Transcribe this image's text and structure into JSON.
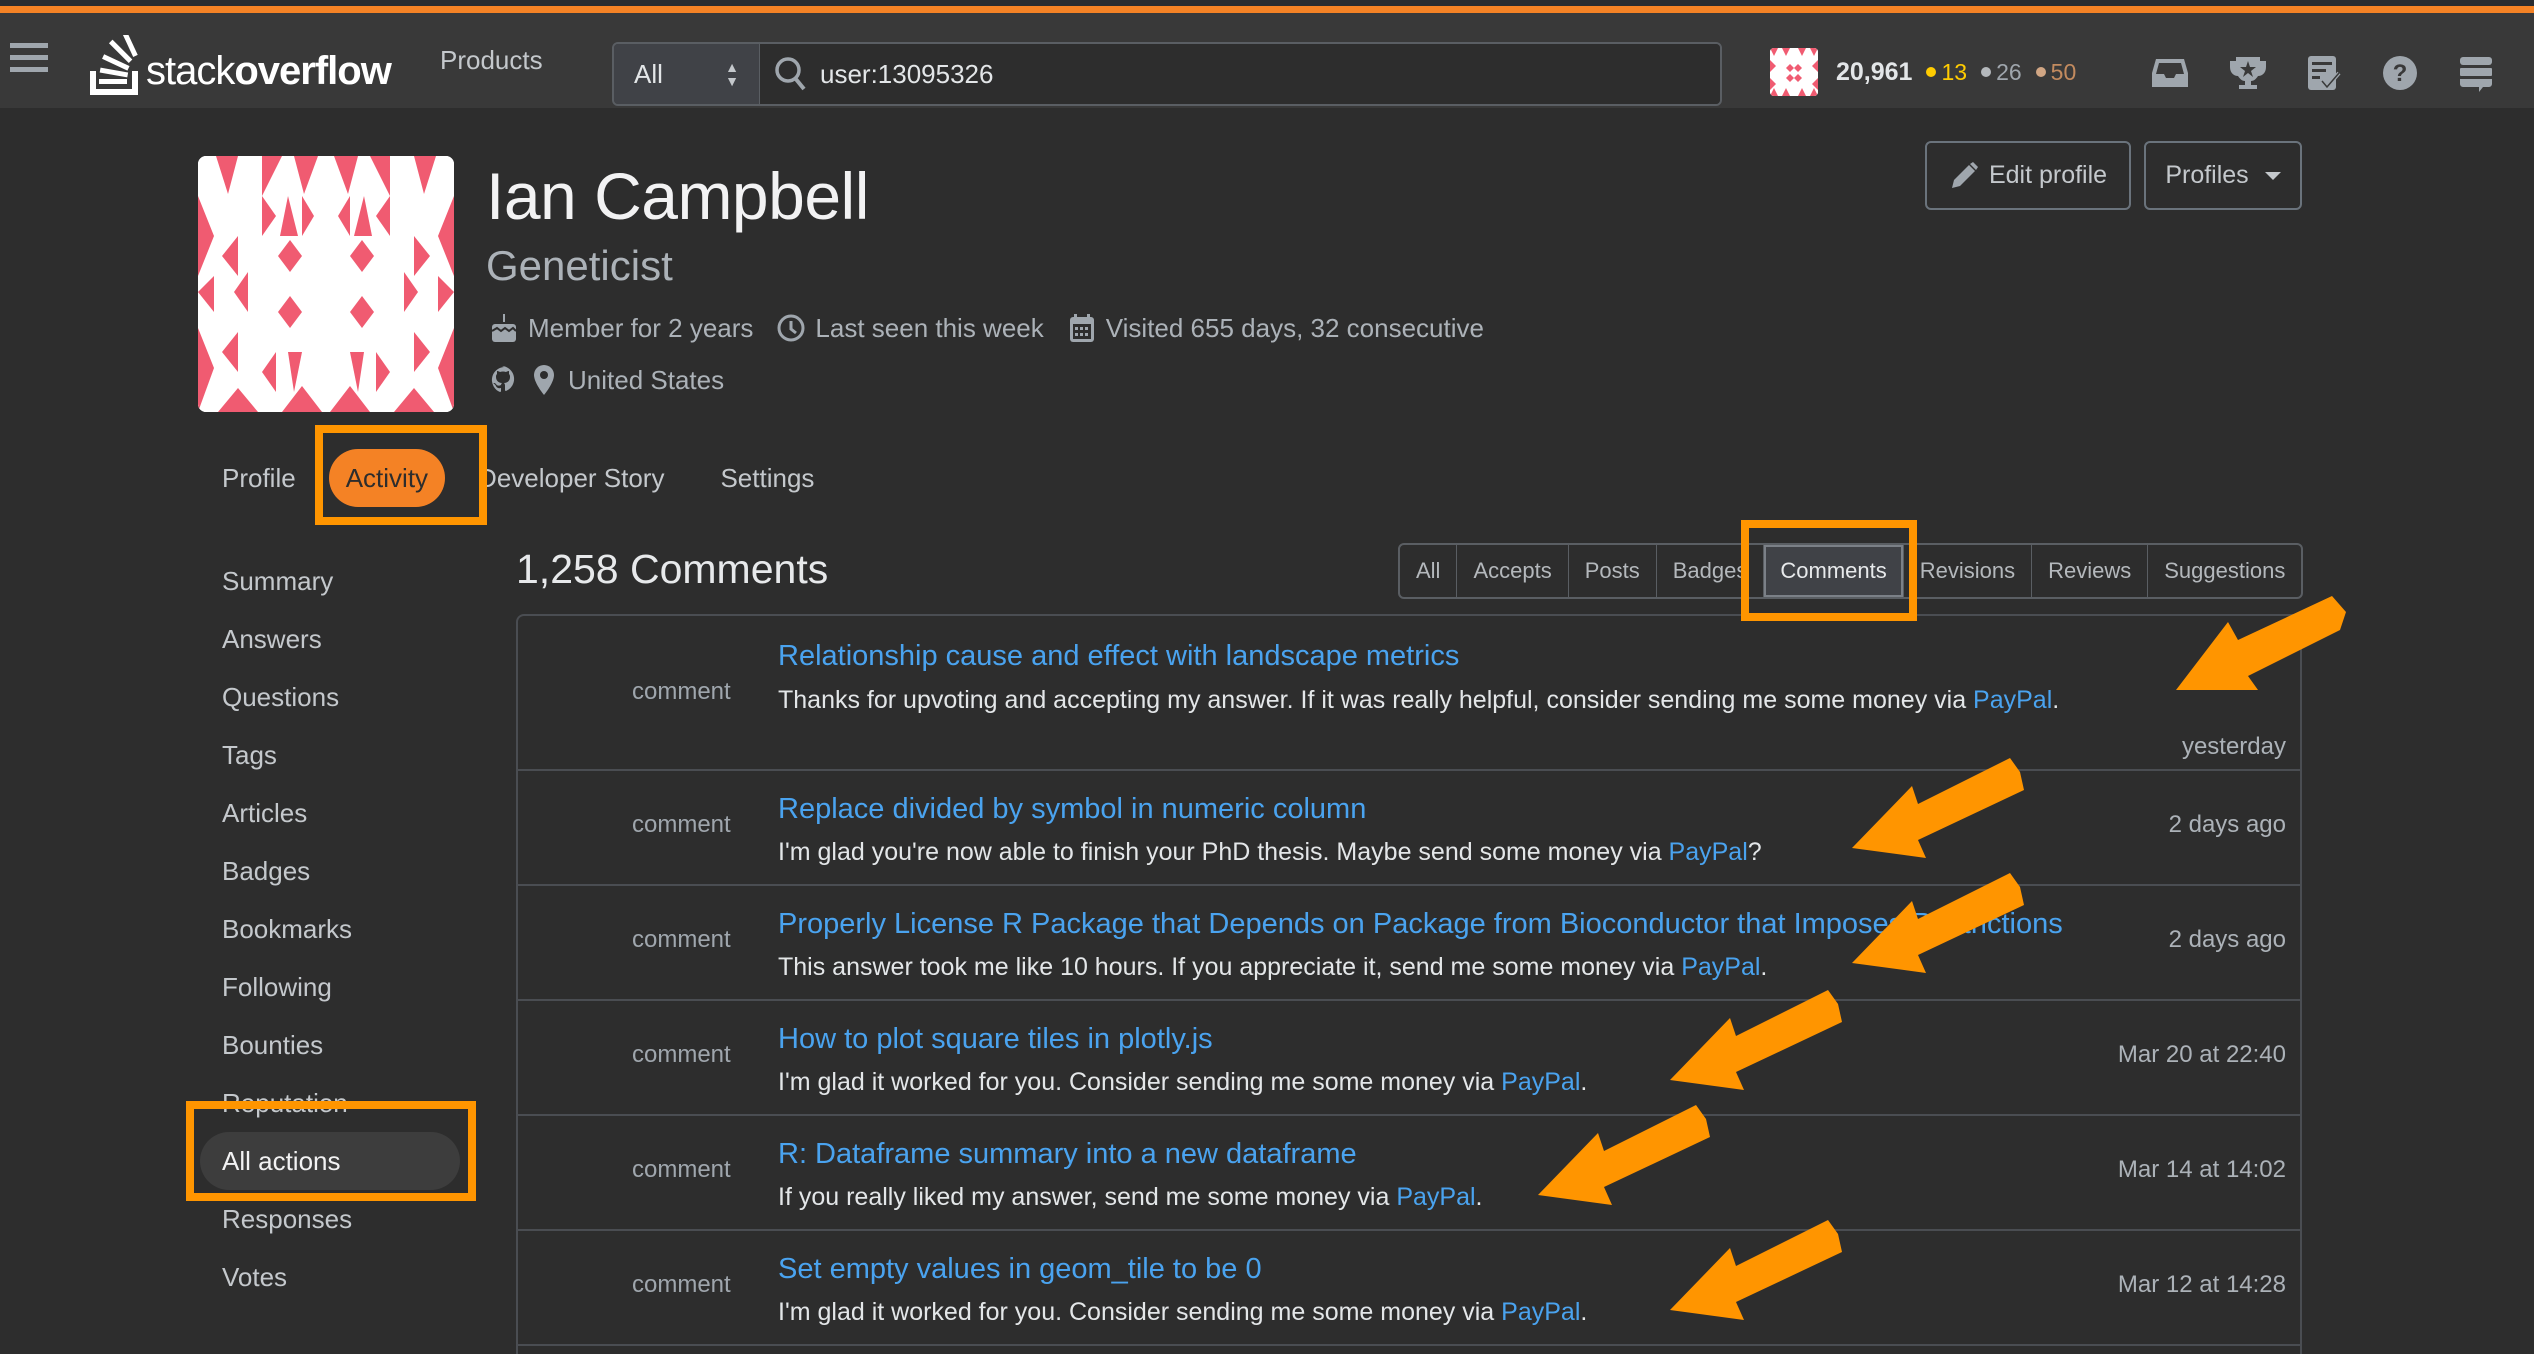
{
  "header": {
    "logo_text_light": "stack",
    "logo_text_bold": "overflow",
    "products_label": "Products",
    "search_scope": "All",
    "search_value": "user:13095326",
    "reputation": "20,961",
    "badges": {
      "gold": "13",
      "silver": "26",
      "bronze": "50"
    },
    "icons": [
      "inbox-icon",
      "achievements-icon",
      "review-queue-icon",
      "help-icon",
      "site-switcher-icon"
    ],
    "colors": {
      "accent": "#f48225",
      "link": "#4aa3ef",
      "gold": "#ffcc01",
      "silver": "#9fa6ad",
      "bronze": "#c38b5f"
    }
  },
  "profile": {
    "name": "Ian Campbell",
    "title": "Geneticist",
    "member_for": "Member for 2 years",
    "last_seen": "Last seen this week",
    "visited": "Visited 655 days, 32 consecutive",
    "location": "United States",
    "edit_label": "Edit profile",
    "profiles_label": "Profiles"
  },
  "profile_tabs": [
    {
      "label": "Profile",
      "active": false
    },
    {
      "label": "Activity",
      "active": true
    },
    {
      "label": "Developer Story",
      "active": false
    },
    {
      "label": "Settings",
      "active": false
    }
  ],
  "sidebar": {
    "items": [
      {
        "label": "Summary"
      },
      {
        "label": "Answers"
      },
      {
        "label": "Questions"
      },
      {
        "label": "Tags"
      },
      {
        "label": "Articles"
      },
      {
        "label": "Badges"
      },
      {
        "label": "Bookmarks"
      },
      {
        "label": "Following"
      },
      {
        "label": "Bounties"
      },
      {
        "label": "Reputation"
      },
      {
        "label": "All actions",
        "active": true
      },
      {
        "label": "Responses"
      },
      {
        "label": "Votes"
      }
    ]
  },
  "main": {
    "section_title": "1,258 Comments",
    "filters": [
      {
        "label": "All"
      },
      {
        "label": "Accepts"
      },
      {
        "label": "Posts"
      },
      {
        "label": "Badges"
      },
      {
        "label": "Comments",
        "active": true
      },
      {
        "label": "Revisions"
      },
      {
        "label": "Reviews"
      },
      {
        "label": "Suggestions"
      }
    ],
    "comments": [
      {
        "type": "comment",
        "title": "Relationship cause and effect with landscape metrics",
        "text_before": "Thanks for upvoting and accepting my answer. If it was really helpful, consider sending me some money via ",
        "link": "PayPal",
        "text_after": ".",
        "date": "yesterday"
      },
      {
        "type": "comment",
        "title": "Replace divided by symbol in numeric column",
        "text_before": "I'm glad you're now able to finish your PhD thesis. Maybe send some money via ",
        "link": "PayPal",
        "text_after": "?",
        "date": "2 days ago"
      },
      {
        "type": "comment",
        "title": "Properly License R Package that Depends on Package from Bioconductor that Imposes Restrictions",
        "text_before": "This answer took me like 10 hours. If you appreciate it, send me some money via ",
        "link": "PayPal",
        "text_after": ".",
        "date": "2 days ago"
      },
      {
        "type": "comment",
        "title": "How to plot square tiles in plotly.js",
        "text_before": "I'm glad it worked for you. Consider sending me some money via ",
        "link": "PayPal",
        "text_after": ".",
        "date": "Mar 20 at 22:40"
      },
      {
        "type": "comment",
        "title": "R: Dataframe summary into a new dataframe",
        "text_before": "If you really liked my answer, send me some money via ",
        "link": "PayPal",
        "text_after": ".",
        "date": "Mar 14 at 14:02"
      },
      {
        "type": "comment",
        "title": "Set empty values in geom_tile to be 0",
        "text_before": "I'm glad it worked for you. Consider sending me some money via ",
        "link": "PayPal",
        "text_after": ".",
        "date": "Mar 12 at 14:28"
      }
    ]
  }
}
